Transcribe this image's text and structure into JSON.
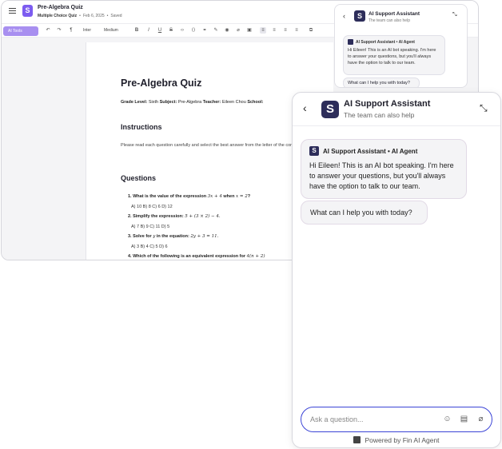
{
  "editor": {
    "doc_title": "Pre-Algebra Quiz",
    "doc_type": "Multiple Choice Quiz",
    "date": "Feb 6, 2025",
    "save_state": "Saved",
    "toolbar": {
      "ai_tools": "AI Tools",
      "font": "Inter",
      "weight": "Medium"
    }
  },
  "document": {
    "title": "Pre-Algebra Quiz",
    "grade_label": "Grade Level:",
    "grade_value": "Sixth",
    "subject_label": "Subject:",
    "subject_value": "Pre-Algebra",
    "teacher_label": "Teacher:",
    "teacher_value": "Eileen Chou",
    "school_label": "School:",
    "instructions_heading": "Instructions",
    "instructions_text": "Please read each question carefully and select the best answer from the letter of the correct answer.",
    "questions_heading": "Questions",
    "questions": [
      {
        "prompt": "1. What is the value of the expression",
        "math": "3x + 4",
        "mid": "when",
        "math2": "x = 2",
        "end": "?",
        "answers": "A) 10  B) 8  C) 6  D) 12"
      },
      {
        "prompt": "2. Simplify the expression:",
        "math": "5 + (3 × 2) − 4.",
        "mid": "",
        "math2": "",
        "end": "",
        "answers": "A) 7  B) 9  C) 11  D) 5"
      },
      {
        "prompt": "3. Solve for",
        "math": "y",
        "mid": "in the equation:",
        "math2": "2y + 3 = 11.",
        "end": "",
        "answers": "A) 3  B) 4  C) 5  D) 6"
      },
      {
        "prompt": "4. Which of the following is an equivalent expression for",
        "math": "4(n + 2)",
        "mid": "",
        "math2": "",
        "end": "",
        "answers": ""
      }
    ]
  },
  "mini_chat": {
    "title": "AI Support Assistant",
    "subtitle": "The team can also help",
    "agent_label": "AI Support Assistant • AI Agent",
    "message": "Hi Eileen! This is an AI bot speaking. I'm here to answer your questions, but you'll always have the option to talk to our team.",
    "question": "What can I help you with today?"
  },
  "chat": {
    "title": "AI Support Assistant",
    "subtitle": "The team can also help",
    "agent_label": "AI Support Assistant • AI Agent",
    "message": "Hi Eileen! This is an AI bot speaking. I'm here to answer your questions, but you'll always have the option to talk to our team.",
    "question": "What can I help you with today?",
    "input_placeholder": "Ask a question...",
    "powered_by": "Powered by Fin AI Agent"
  }
}
